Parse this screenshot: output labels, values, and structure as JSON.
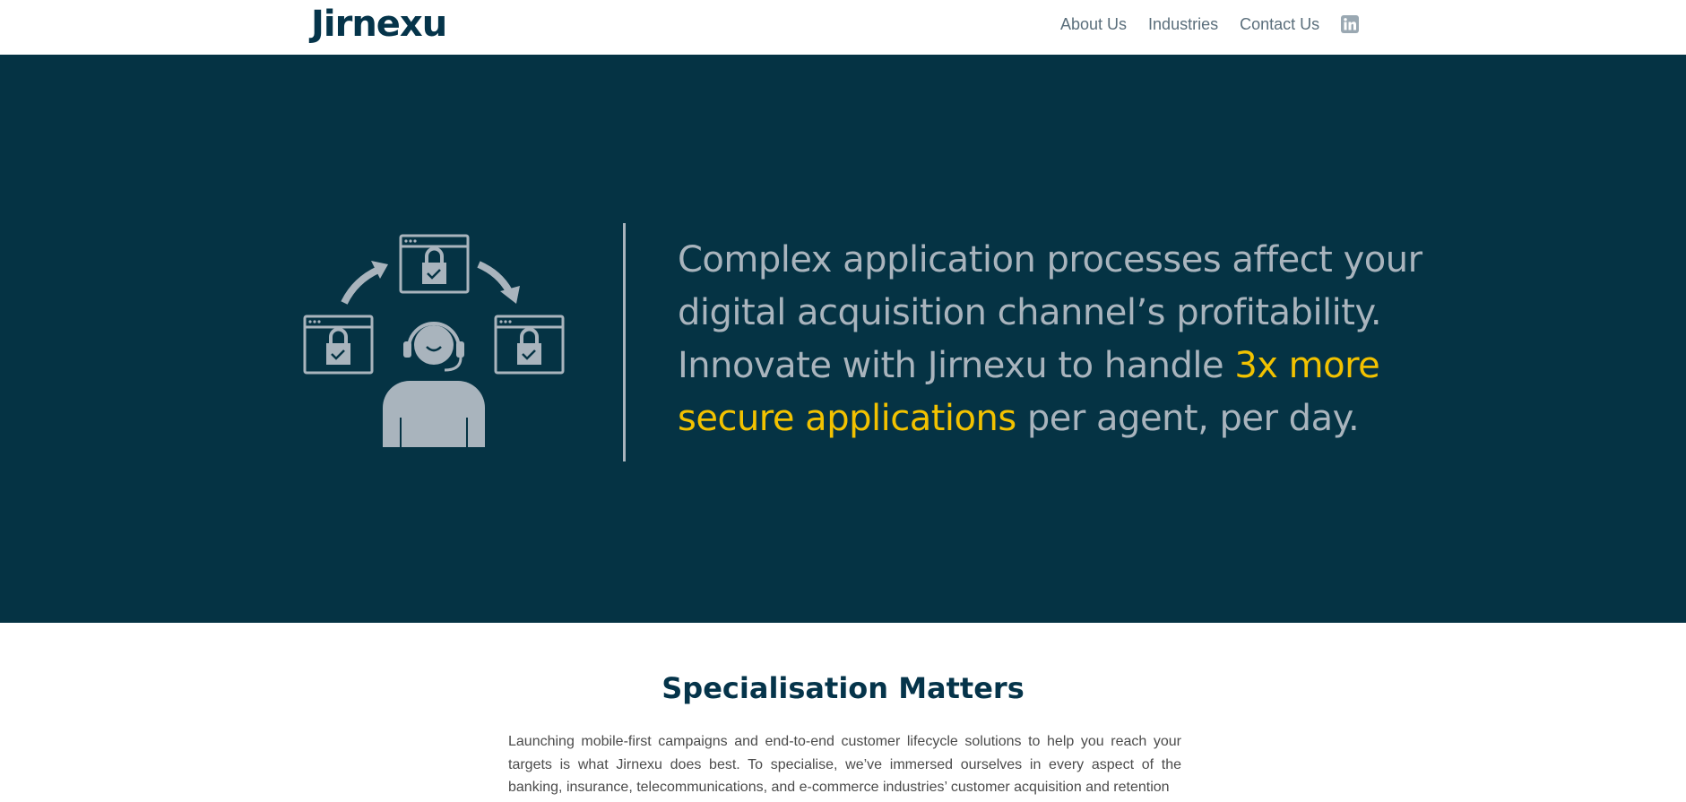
{
  "header": {
    "logo_text": "Jirnexu",
    "nav": [
      {
        "label": "About Us"
      },
      {
        "label": "Industries"
      },
      {
        "label": "Contact Us"
      }
    ],
    "social_icon": "linkedin-icon"
  },
  "hero": {
    "text_part1": "Complex application processes affect your digital acquisition channel’s profitability. Innovate with Jirnexu to handle ",
    "text_highlight": "3x more secure applications",
    "text_part2": " per agent, per day.",
    "colors": {
      "background": "#053344",
      "text": "#a9b4bd",
      "highlight": "#f2c200"
    }
  },
  "specialisation": {
    "title": "Specialisation Matters",
    "body": "Launching mobile-first campaigns and end-to-end customer lifecycle solutions to help you reach your targets is what Jirnexu does best. To specialise, we’ve immersed ourselves in every aspect of the banking, insurance, telecommunications, and e-commerce industries’ customer acquisition and retention"
  }
}
